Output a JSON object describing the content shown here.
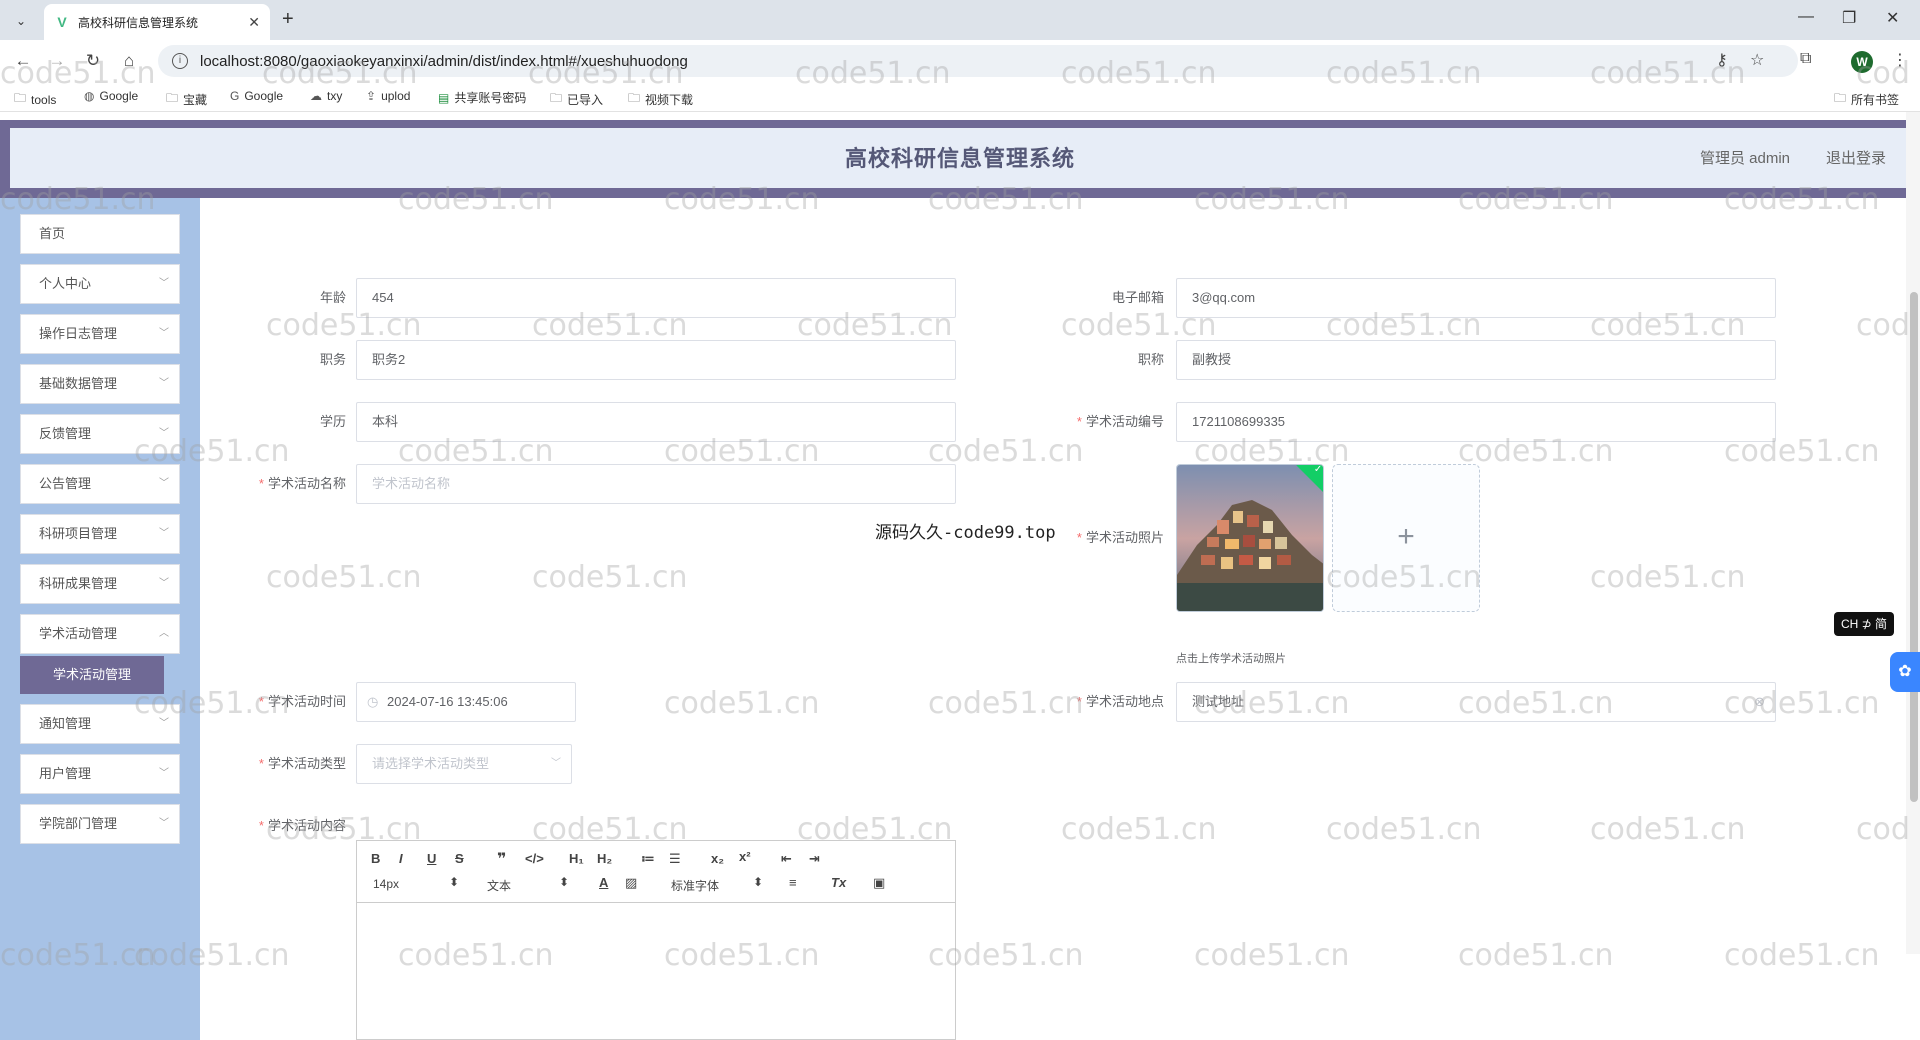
{
  "browser": {
    "tab_title": "高校科研信息管理系统",
    "tab_close": "✕",
    "new_tab": "+",
    "url": "localhost:8080/gaoxiaokeyanxinxi/admin/dist/index.html#/xueshuhuodong",
    "profile_initial": "W",
    "bookmarks": [
      "tools",
      "Google",
      "宝藏",
      "Google",
      "txy",
      "uplod",
      "共享账号密码",
      "已导入",
      "视频下载"
    ],
    "all_bookmarks": "所有书签"
  },
  "header": {
    "title": "高校科研信息管理系统",
    "user": "管理员 admin",
    "logout": "退出登录"
  },
  "sidebar": {
    "items": [
      {
        "label": "首页"
      },
      {
        "label": "个人中心"
      },
      {
        "label": "操作日志管理"
      },
      {
        "label": "基础数据管理"
      },
      {
        "label": "反馈管理"
      },
      {
        "label": "公告管理"
      },
      {
        "label": "科研项目管理"
      },
      {
        "label": "科研成果管理"
      },
      {
        "label": "学术活动管理"
      },
      {
        "label": "通知管理"
      },
      {
        "label": "用户管理"
      },
      {
        "label": "学院部门管理"
      }
    ],
    "active_sub": "学术活动管理"
  },
  "form": {
    "age": {
      "label": "年龄",
      "value": "454"
    },
    "email": {
      "label": "电子邮箱",
      "value": "3@qq.com"
    },
    "position": {
      "label": "职务",
      "value": "职务2"
    },
    "title": {
      "label": "职称",
      "value": "副教授"
    },
    "education": {
      "label": "学历",
      "value": "本科"
    },
    "activity_no": {
      "label": "学术活动编号",
      "value": "1721108699335"
    },
    "activity_name": {
      "label": "学术活动名称",
      "placeholder": "学术活动名称"
    },
    "activity_photo": {
      "label": "学术活动照片",
      "tip": "点击上传学术活动照片",
      "add": "+"
    },
    "activity_time": {
      "label": "学术活动时间",
      "value": "2024-07-16 13:45:06"
    },
    "activity_place": {
      "label": "学术活动地点",
      "value": "测试地址"
    },
    "activity_type": {
      "label": "学术活动类型",
      "placeholder": "请选择学术活动类型"
    },
    "activity_content": {
      "label": "学术活动内容"
    }
  },
  "editor": {
    "font_size": "14px",
    "format": "文本",
    "font": "标准字体"
  },
  "overlay": "源码久久-code99.top",
  "ime": "CH ⊅ 简",
  "watermark": "code51.cn",
  "watermark_partial": "cod",
  "colors": {
    "header_border": "#6f6995",
    "sidebar_bg": "#a7c2e6",
    "submenu_active": "#6f6995",
    "required": "#f56c6c"
  }
}
